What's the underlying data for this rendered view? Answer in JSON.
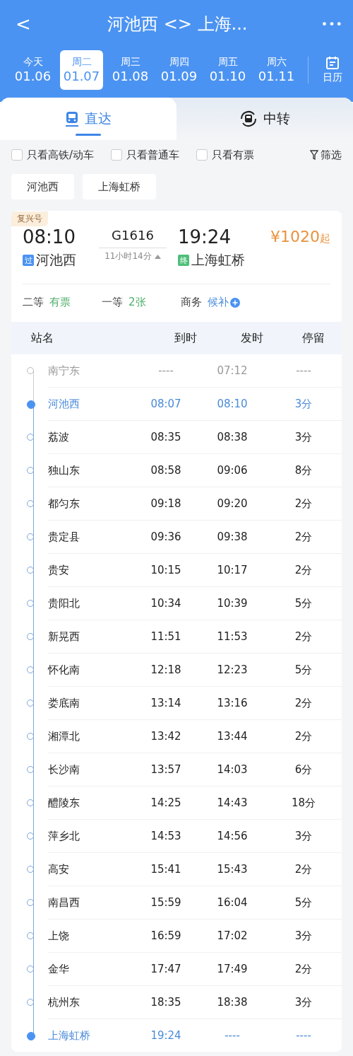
{
  "header": {
    "back": "<",
    "title": "河池西 <> 上海...",
    "more": "•••"
  },
  "dates": [
    {
      "weekday": "今天",
      "date": "01.06",
      "selected": false
    },
    {
      "weekday": "周二",
      "date": "01.07",
      "selected": true
    },
    {
      "weekday": "周三",
      "date": "01.08",
      "selected": false
    },
    {
      "weekday": "周四",
      "date": "01.09",
      "selected": false
    },
    {
      "weekday": "周五",
      "date": "01.10",
      "selected": false
    },
    {
      "weekday": "周六",
      "date": "01.11",
      "selected": false
    }
  ],
  "calendar": "日历",
  "tabs": [
    {
      "label": "直达",
      "selected": true
    },
    {
      "label": "中转",
      "selected": false
    }
  ],
  "filters": [
    {
      "label": "只看高铁/动车",
      "checked": false
    },
    {
      "label": "只看普通车",
      "checked": false
    },
    {
      "label": "只看有票",
      "checked": false
    }
  ],
  "filter_button": "筛选",
  "station_chips": [
    "河池西",
    "上海虹桥"
  ],
  "train": {
    "badge": "复兴号",
    "depart_time": "08:10",
    "number": "G1616",
    "arrive_time": "19:24",
    "price": "¥1020",
    "price_suffix": "起",
    "depart_tag": "过",
    "depart_station": "河池西",
    "duration": "11小时14分",
    "arrive_tag": "终",
    "arrive_station": "上海虹桥",
    "seats": [
      {
        "class": "二等",
        "status": "有票",
        "kind": "available"
      },
      {
        "class": "一等",
        "status": "2张",
        "kind": "available"
      },
      {
        "class": "商务",
        "status": "候补",
        "kind": "waitlist"
      }
    ]
  },
  "stops_table": {
    "columns": [
      "站名",
      "到时",
      "发时",
      "停留"
    ],
    "rows": [
      {
        "station": "南宁东",
        "arrive": "----",
        "depart": "07:12",
        "stop": "----",
        "kind": "passed"
      },
      {
        "station": "河池西",
        "arrive": "08:07",
        "depart": "08:10",
        "stop": "3分",
        "kind": "endpoint"
      },
      {
        "station": "荔波",
        "arrive": "08:35",
        "depart": "08:38",
        "stop": "3分",
        "kind": "normal"
      },
      {
        "station": "独山东",
        "arrive": "08:58",
        "depart": "09:06",
        "stop": "8分",
        "kind": "normal"
      },
      {
        "station": "都匀东",
        "arrive": "09:18",
        "depart": "09:20",
        "stop": "2分",
        "kind": "normal"
      },
      {
        "station": "贵定县",
        "arrive": "09:36",
        "depart": "09:38",
        "stop": "2分",
        "kind": "normal"
      },
      {
        "station": "贵安",
        "arrive": "10:15",
        "depart": "10:17",
        "stop": "2分",
        "kind": "normal"
      },
      {
        "station": "贵阳北",
        "arrive": "10:34",
        "depart": "10:39",
        "stop": "5分",
        "kind": "normal"
      },
      {
        "station": "新晃西",
        "arrive": "11:51",
        "depart": "11:53",
        "stop": "2分",
        "kind": "normal"
      },
      {
        "station": "怀化南",
        "arrive": "12:18",
        "depart": "12:23",
        "stop": "5分",
        "kind": "normal"
      },
      {
        "station": "娄底南",
        "arrive": "13:14",
        "depart": "13:16",
        "stop": "2分",
        "kind": "normal"
      },
      {
        "station": "湘潭北",
        "arrive": "13:42",
        "depart": "13:44",
        "stop": "2分",
        "kind": "normal"
      },
      {
        "station": "长沙南",
        "arrive": "13:57",
        "depart": "14:03",
        "stop": "6分",
        "kind": "normal"
      },
      {
        "station": "醴陵东",
        "arrive": "14:25",
        "depart": "14:43",
        "stop": "18分",
        "kind": "normal"
      },
      {
        "station": "萍乡北",
        "arrive": "14:53",
        "depart": "14:56",
        "stop": "3分",
        "kind": "normal"
      },
      {
        "station": "高安",
        "arrive": "15:41",
        "depart": "15:43",
        "stop": "2分",
        "kind": "normal"
      },
      {
        "station": "南昌西",
        "arrive": "15:59",
        "depart": "16:04",
        "stop": "5分",
        "kind": "normal"
      },
      {
        "station": "上饶",
        "arrive": "16:59",
        "depart": "17:02",
        "stop": "3分",
        "kind": "normal"
      },
      {
        "station": "金华",
        "arrive": "17:47",
        "depart": "17:49",
        "stop": "2分",
        "kind": "normal"
      },
      {
        "station": "杭州东",
        "arrive": "18:35",
        "depart": "18:38",
        "stop": "3分",
        "kind": "normal"
      },
      {
        "station": "上海虹桥",
        "arrive": "19:24",
        "depart": "----",
        "stop": "----",
        "kind": "endpoint"
      }
    ]
  }
}
